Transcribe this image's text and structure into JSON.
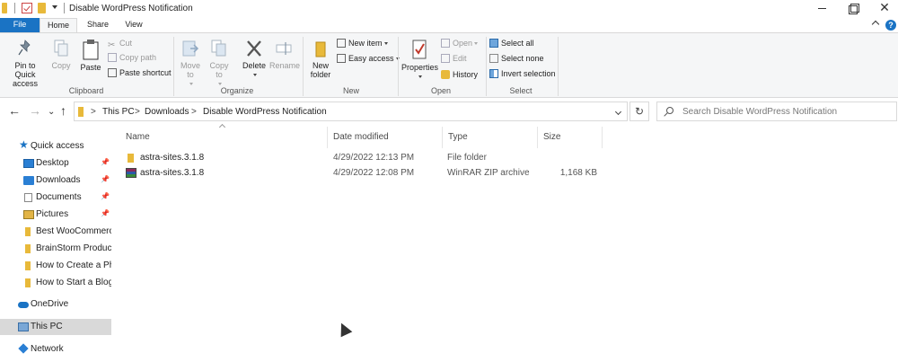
{
  "window": {
    "title": "Disable WordPress Notification",
    "close_glyph": "✕",
    "help_glyph": "?"
  },
  "tabs": [
    {
      "label": "File"
    },
    {
      "label": "Home"
    },
    {
      "label": "Share"
    },
    {
      "label": "View"
    }
  ],
  "ribbon": {
    "clipboard": {
      "label": "Clipboard",
      "pin": "Pin to Quick access",
      "copy": "Copy",
      "paste": "Paste",
      "cut": "Cut",
      "copy_path": "Copy path",
      "paste_shortcut": "Paste shortcut"
    },
    "organize": {
      "label": "Organize",
      "move_to": "Move to",
      "copy_to": "Copy to",
      "delete": "Delete",
      "rename": "Rename"
    },
    "new": {
      "label": "New",
      "new_folder": "New folder",
      "new_item": "New item",
      "easy_access": "Easy access"
    },
    "open": {
      "label": "Open",
      "properties": "Properties",
      "open": "Open",
      "edit": "Edit",
      "history": "History"
    },
    "select": {
      "label": "Select",
      "select_all": "Select all",
      "select_none": "Select none",
      "invert": "Invert selection"
    }
  },
  "address": {
    "crumbs": [
      "This PC",
      "Downloads",
      "Disable WordPress Notification"
    ],
    "separator": ">",
    "back": "←",
    "forward": "→",
    "up": "↑",
    "recent": "⌄",
    "refresh": "↻",
    "search_placeholder": "Search Disable WordPress Notification"
  },
  "nav": {
    "pin_glyph": "📌",
    "items": [
      {
        "label": "Quick access",
        "icon": "star-icon"
      },
      {
        "label": "Desktop",
        "icon": "desktop-icon",
        "pinned": true
      },
      {
        "label": "Downloads",
        "icon": "download-icon",
        "pinned": true
      },
      {
        "label": "Documents",
        "icon": "document-icon",
        "pinned": true
      },
      {
        "label": "Pictures",
        "icon": "pictures-icon",
        "pinned": true
      },
      {
        "label": "Best WooCommerce",
        "icon": "folder-icon"
      },
      {
        "label": "BrainStorm Products",
        "icon": "folder-icon"
      },
      {
        "label": "How to Create a Pho",
        "icon": "folder-icon"
      },
      {
        "label": "How to Start a Blog",
        "icon": "folder-icon"
      },
      {
        "label": "OneDrive",
        "icon": "cloud-icon"
      },
      {
        "label": "This PC",
        "icon": "computer-icon",
        "selected": true
      },
      {
        "label": "Network",
        "icon": "network-icon"
      }
    ]
  },
  "files": {
    "columns": [
      "Name",
      "Date modified",
      "Type",
      "Size"
    ],
    "rows": [
      {
        "name": "astra-sites.3.1.8",
        "date": "4/29/2022 12:13 PM",
        "type": "File folder",
        "size": ""
      },
      {
        "name": "astra-sites.3.1.8",
        "date": "4/29/2022 12:08 PM",
        "type": "WinRAR ZIP archive",
        "size": "1,168 KB"
      }
    ]
  },
  "colors": {
    "accent": "#1a73c4",
    "folder": "#e8b93a",
    "ribbon_bg": "#f5f6f7",
    "selection": "#d9d9d9"
  }
}
